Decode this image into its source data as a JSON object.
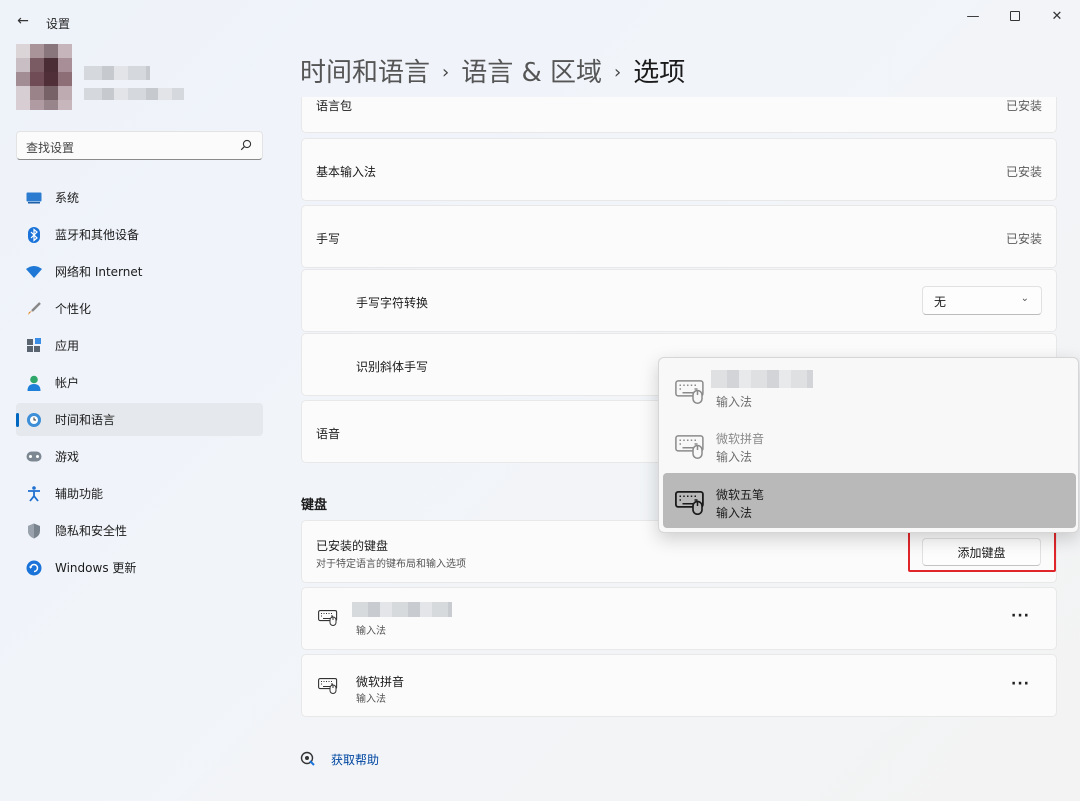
{
  "window": {
    "title": "设置",
    "back": "←",
    "minimize": "—",
    "close": "✕"
  },
  "search": {
    "placeholder": "查找设置"
  },
  "nav": [
    {
      "label": "系统",
      "icon": "monitor-icon"
    },
    {
      "label": "蓝牙和其他设备",
      "icon": "bluetooth-icon"
    },
    {
      "label": "网络和 Internet",
      "icon": "wifi-icon"
    },
    {
      "label": "个性化",
      "icon": "brush-icon"
    },
    {
      "label": "应用",
      "icon": "apps-icon"
    },
    {
      "label": "帐户",
      "icon": "person-icon"
    },
    {
      "label": "时间和语言",
      "icon": "globe-clock-icon",
      "active": true
    },
    {
      "label": "游戏",
      "icon": "gamepad-icon"
    },
    {
      "label": "辅助功能",
      "icon": "accessibility-icon"
    },
    {
      "label": "隐私和安全性",
      "icon": "shield-icon"
    },
    {
      "label": "Windows 更新",
      "icon": "update-icon"
    }
  ],
  "breadcrumb": {
    "parts": [
      "时间和语言",
      "语言 & 区域",
      "选项"
    ],
    "sep": "›"
  },
  "rows": {
    "lang_pack": {
      "label": "语言包",
      "value": "已安装"
    },
    "basic_input": {
      "label": "基本输入法",
      "value": "已安装"
    },
    "handwriting": {
      "label": "手写",
      "value": "已安装"
    },
    "hw_conversion": {
      "label": "手写字符转换",
      "selected": "无"
    },
    "hw_italic": {
      "label": "识别斜体手写"
    },
    "speech": {
      "label": "语音"
    }
  },
  "keyboard_section": {
    "title": "键盘",
    "installed_title": "已安装的键盘",
    "installed_desc": "对于特定语言的键布局和输入选项",
    "add_button": "添加键盘",
    "items": [
      {
        "name": "",
        "sub": "输入法"
      },
      {
        "name": "微软拼音",
        "sub": "输入法"
      }
    ],
    "more": "···"
  },
  "popup": {
    "items": [
      {
        "name": "",
        "sub": "输入法",
        "selected": false
      },
      {
        "name": "微软拼音",
        "sub": "输入法",
        "selected": false
      },
      {
        "name": "微软五笔",
        "sub": "输入法",
        "selected": true
      }
    ]
  },
  "help": {
    "label": "获取帮助"
  },
  "colors": {
    "accent": "#0067c0",
    "highlight_border": "#e0262b",
    "link": "#0046a0"
  }
}
